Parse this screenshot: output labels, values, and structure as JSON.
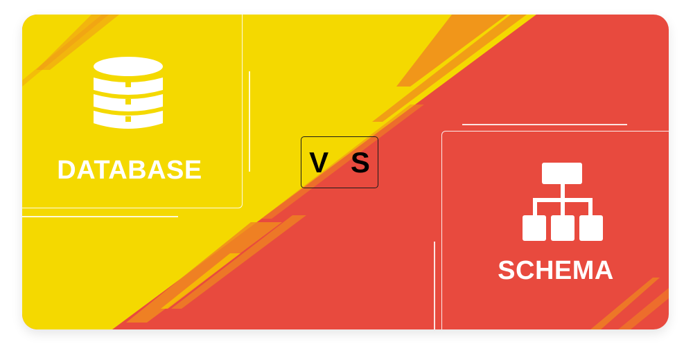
{
  "left": {
    "label": "DATABASE",
    "icon": "database-icon"
  },
  "right": {
    "label": "SCHEMA",
    "icon": "hierarchy-icon"
  },
  "vs_label": "V S",
  "colors": {
    "yellow": "#F4D900",
    "red": "#E84A3E",
    "orange_streak": "#F08A1E",
    "white": "#FFFFFF"
  }
}
